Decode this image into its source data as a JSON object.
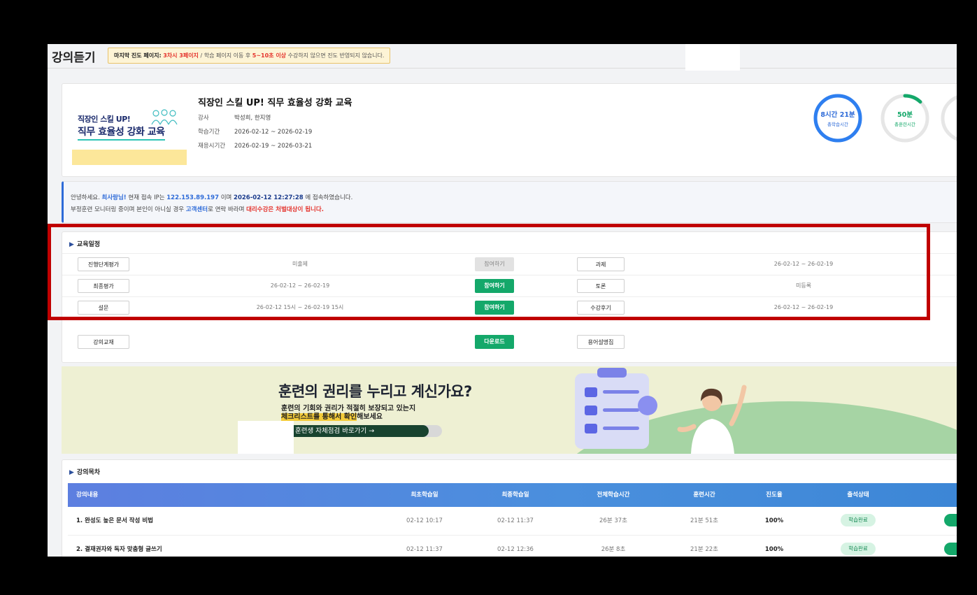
{
  "header": {
    "title": "강의듣기",
    "notice": {
      "prefix": "마지막 진도 페이지:",
      "last_page": "3차시 3페이지",
      "middle": "/ 학습 페이지 이동 후",
      "duration": "5~10초 이상",
      "suffix": "수강하지 않으면 진도 반영되지 않습니다."
    }
  },
  "course": {
    "thumb_line1": "직장인 스킬 UP!",
    "thumb_line2": "직무 효율성 강화 교육",
    "title": "직장인 스킬 UP! 직무 효율성 강화 교육",
    "instructor_label": "강사",
    "instructor": "박성희, 한지영",
    "period_label": "학습기간",
    "period": "2026-02-12 ~ 2026-02-19",
    "review_label": "재응시기간",
    "review_period": "2026-02-19 ~ 2026-03-21",
    "stats": [
      {
        "value": "8시간 21분",
        "label": "총학습시간",
        "progress": 1.0,
        "color": "#2e7ff0"
      },
      {
        "value": "50분",
        "label": "총훈련시간",
        "progress": 0.12,
        "color": "#14a86a"
      }
    ]
  },
  "info": {
    "greet": "안녕하세요.",
    "user": "최사랑님!",
    "ip_label": "현재 접속 IP는",
    "ip": "122.153.89.197",
    "mid": "이며",
    "datetime": "2026-02-12 12:27:28",
    "tail": "에 접속하였습니다.",
    "line2_a": "부정훈련 모니터링 중이며 본인이 아니실 경우",
    "support": "고객센터",
    "line2_b": "로 연락 바라며",
    "warn": "대리수강은 처벌대상이 됩니다."
  },
  "schedule": {
    "title": "교육일정",
    "rows": [
      {
        "left_label": "진행단계평가",
        "left_value": "미출제",
        "action": "참여하기",
        "action_enabled": false,
        "right_label": "과제",
        "right_value": "26-02-12 ~ 26-02-19"
      },
      {
        "left_label": "최종평가",
        "left_value": "26-02-12 ~ 26-02-19",
        "action": "참여하기",
        "action_enabled": true,
        "right_label": "토론",
        "right_value": "미등록"
      },
      {
        "left_label": "설문",
        "left_value": "26-02-12 15시 ~ 26-02-19 15시",
        "action": "참여하기",
        "action_enabled": true,
        "right_label": "수강후기",
        "right_value": "26-02-12 ~ 26-02-19"
      },
      {
        "left_label": "강의교재",
        "left_value": "",
        "action": "다운로드",
        "action_enabled": true,
        "right_label": "용어설명집",
        "right_value": ""
      }
    ]
  },
  "banner": {
    "headline": "훈련의 권리를 누리고 계신가요?",
    "sub1": "훈련의 기회와 권리가 적절히 보장되고 있는지",
    "sub2_highlight": "체크리스트를 통해서 확인",
    "sub2_tail": "해보세요",
    "cta": "훈련생 자체점검 바로가기 →"
  },
  "toc": {
    "title": "강의목차",
    "columns": [
      "강의내용",
      "최초학습일",
      "최종학습일",
      "전체학습시간",
      "훈련시간",
      "진도율",
      "출석상태"
    ],
    "rows": [
      {
        "name": "1. 완성도 높은 문서 작성 비법",
        "first": "02-12 10:17",
        "last": "02-12 11:37",
        "total": "26분 37초",
        "train": "21분 51초",
        "progress": "100%",
        "status": "학습완료"
      },
      {
        "name": "2. 결재권자와 독자 맞춤형 글쓰기",
        "first": "02-12 11:37",
        "last": "02-12 12:36",
        "total": "26분 8초",
        "train": "21분 22초",
        "progress": "100%",
        "status": "학습완료"
      }
    ]
  }
}
